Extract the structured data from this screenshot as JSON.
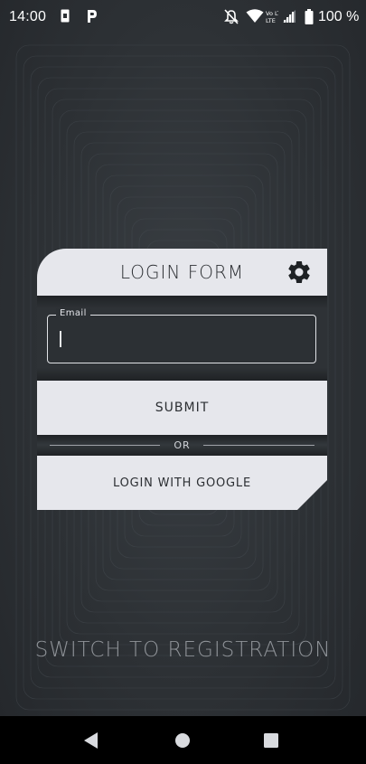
{
  "status_bar": {
    "time": "14:00",
    "battery_percent": "100 %",
    "icons": [
      "sim-card-icon",
      "parking-icon",
      "notifications-off-icon",
      "wifi-icon",
      "volte-icon",
      "signal-icon",
      "battery-icon"
    ],
    "volte_label": "Vo LTE"
  },
  "login_form": {
    "title": "LOGIN FORM",
    "email_label": "Email",
    "email_value": "",
    "submit_label": "SUBMIT",
    "divider_text": "OR",
    "google_label": "LOGIN WITH GOOGLE"
  },
  "switch_label": "SWITCH TO REGISTRATION",
  "navigation": {
    "buttons": [
      "back-icon",
      "home-icon",
      "recents-icon"
    ]
  },
  "colors": {
    "card_light": "#e6e7ec",
    "card_dark": "#2e3236",
    "background": "#2d3135",
    "switch_text": "#8f9398"
  }
}
